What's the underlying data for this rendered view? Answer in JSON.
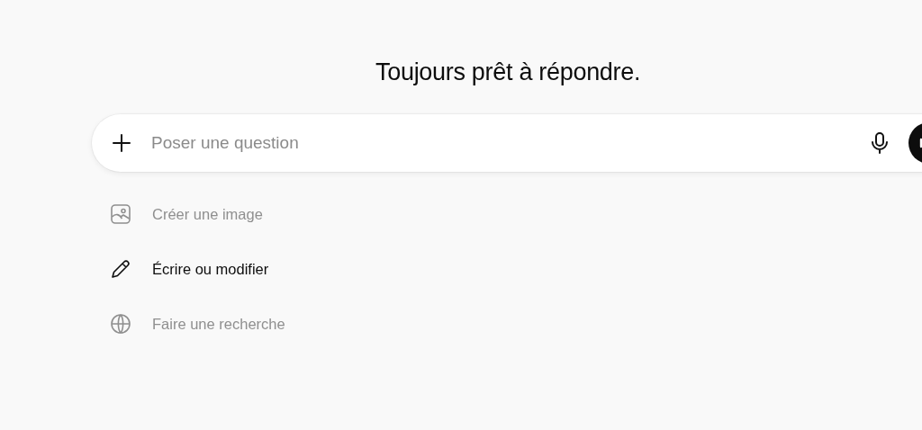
{
  "heading": "Toujours prêt à répondre.",
  "composer": {
    "placeholder": "Poser une question"
  },
  "suggestions": [
    {
      "kind": "image",
      "label": "Créer une image",
      "selected": false
    },
    {
      "kind": "pencil",
      "label": "Écrire ou modifier",
      "selected": true
    },
    {
      "kind": "globe",
      "label": "Faire une recherche",
      "selected": false
    }
  ]
}
